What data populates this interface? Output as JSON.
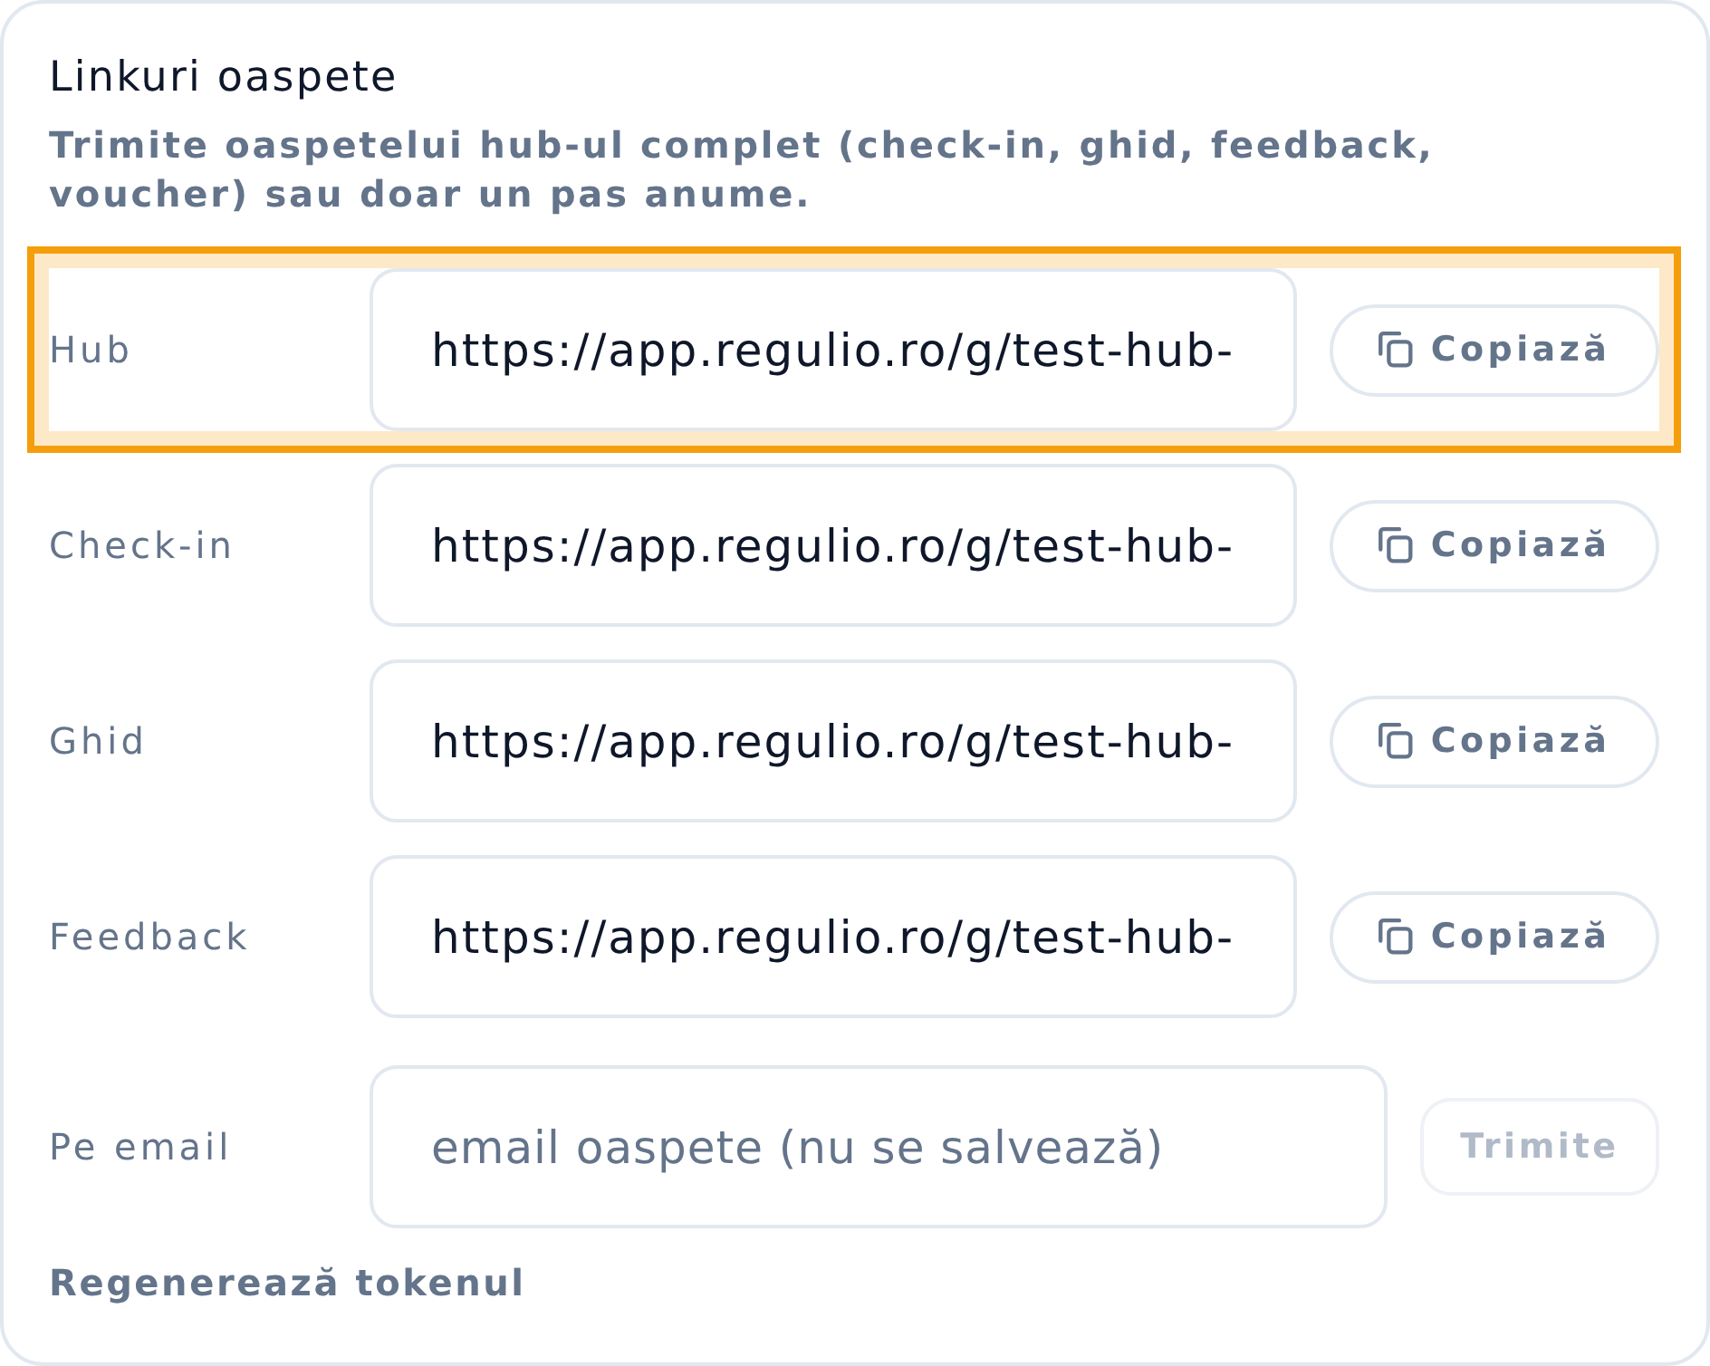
{
  "card": {
    "title": "Linkuri oaspete",
    "description": "Trimite oaspetelui hub-ul complet (check-in, ghid, feedback, voucher) sau doar un pas anume."
  },
  "links": [
    {
      "label": "Hub",
      "url": "https://app.regulio.ro/g/test-hub-",
      "highlighted": true,
      "button": "Copiază"
    },
    {
      "label": "Check-in",
      "url": "https://app.regulio.ro/g/test-hub-",
      "highlighted": false,
      "button": "Copiază"
    },
    {
      "label": "Ghid",
      "url": "https://app.regulio.ro/g/test-hub-",
      "highlighted": false,
      "button": "Copiază"
    },
    {
      "label": "Feedback",
      "url": "https://app.regulio.ro/g/test-hub-",
      "highlighted": false,
      "button": "Copiază"
    }
  ],
  "email": {
    "label": "Pe email",
    "placeholder": "email oaspete (nu se salvează)",
    "button": {
      "label": "Trimite",
      "disabled": true
    }
  },
  "regenerate_link": "Regenerează tokenul"
}
